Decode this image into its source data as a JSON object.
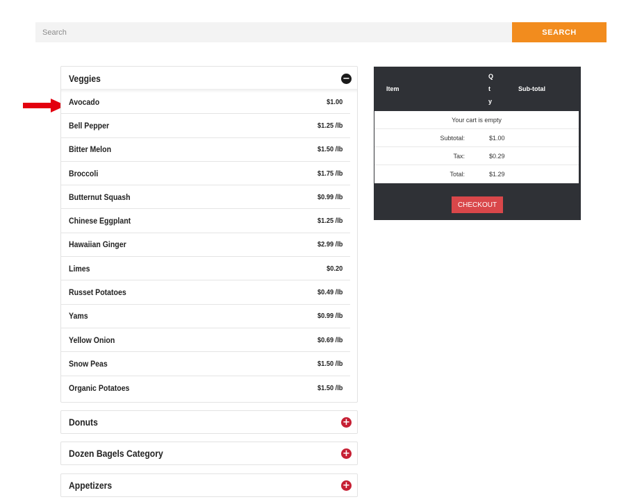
{
  "search": {
    "placeholder": "Search",
    "button_label": "SEARCH"
  },
  "colors": {
    "search_button": "#f28c1e",
    "pointer_arrow": "#e3000f",
    "collapse_icon": "#1a1a1a",
    "expand_icon": "#c62034",
    "cart_background": "#2f3136",
    "checkout_button": "#d9474a"
  },
  "categories": {
    "veggies": {
      "title": "Veggies",
      "icon": "minus-circle-icon",
      "items": [
        {
          "name": "Avocado",
          "price": "$1.00"
        },
        {
          "name": "Bell Pepper",
          "price": "$1.25 /lb"
        },
        {
          "name": "Bitter Melon",
          "price": "$1.50 /lb"
        },
        {
          "name": "Broccoli",
          "price": "$1.75 /lb"
        },
        {
          "name": "Butternut Squash",
          "price": "$0.99 /lb"
        },
        {
          "name": "Chinese Eggplant",
          "price": "$1.25 /lb"
        },
        {
          "name": "Hawaiian Ginger",
          "price": "$2.99 /lb"
        },
        {
          "name": "Limes",
          "price": "$0.20"
        },
        {
          "name": "Russet Potatoes",
          "price": "$0.49 /lb"
        },
        {
          "name": "Yams",
          "price": "$0.99 /lb"
        },
        {
          "name": "Yellow Onion",
          "price": "$0.69 /lb"
        },
        {
          "name": "Snow Peas",
          "price": "$1.50 /lb"
        },
        {
          "name": "Organic Potatoes",
          "price": "$1.50 /lb"
        }
      ]
    },
    "donuts": {
      "title": "Donuts",
      "icon": "plus-circle-icon"
    },
    "bagels": {
      "title": "Dozen Bagels Category",
      "icon": "plus-circle-icon"
    },
    "appetizers": {
      "title": "Appetizers",
      "icon": "plus-circle-icon"
    }
  },
  "cart": {
    "headers": {
      "item": "Item",
      "qty": [
        "Q",
        "t",
        "y"
      ],
      "subtotal": "Sub-total"
    },
    "empty_message": "Your cart is empty",
    "subtotal_label": "Subtotal:",
    "subtotal_value": "$1.00",
    "tax_label": "Tax:",
    "tax_value": "$0.29",
    "total_label": "Total:",
    "total_value": "$1.29",
    "checkout_label": "CHECKOUT"
  }
}
